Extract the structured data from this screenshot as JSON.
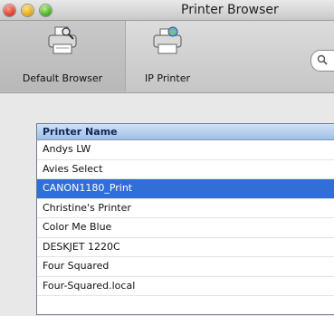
{
  "window": {
    "title": "Printer Browser"
  },
  "toolbar": {
    "default_browser": {
      "label": "Default Browser",
      "icon": "printer-search-icon"
    },
    "ip_printer": {
      "label": "IP Printer",
      "icon": "printer-globe-icon"
    },
    "search": {
      "icon": "search-icon"
    }
  },
  "printer_list": {
    "header": "Printer Name",
    "rows": [
      "Andys LW",
      "Avies Select",
      "CANON1180_Print",
      "Christine's Printer",
      "Color Me Blue",
      "DESKJET 1220C",
      "Four Squared",
      "Four-Squared.local"
    ],
    "selected_index": 2
  },
  "colors": {
    "selection": "#2f6fd6",
    "header_blue": "#9fbfe6"
  }
}
